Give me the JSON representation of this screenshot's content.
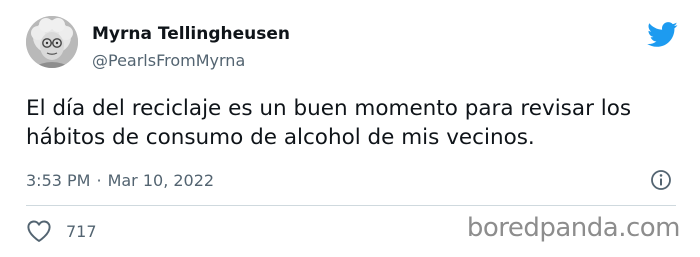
{
  "author": {
    "display_name": "Myrna Tellingheusen",
    "handle": "@PearlsFromMyrna"
  },
  "tweet": {
    "text": "El día del reciclaje es un buen momento para revisar los hábitos de consumo de alcohol de mis vecinos.",
    "time": "3:53 PM",
    "separator": "·",
    "date": "Mar 10, 2022"
  },
  "engagement": {
    "likes": "717"
  },
  "watermark": "boredpanda.com",
  "icons": {
    "logo": "twitter-bird-icon",
    "info": "info-icon",
    "like": "heart-icon"
  },
  "colors": {
    "twitter_blue": "#1d9bf0",
    "secondary_text": "#536471",
    "divider": "#cfd9de"
  }
}
